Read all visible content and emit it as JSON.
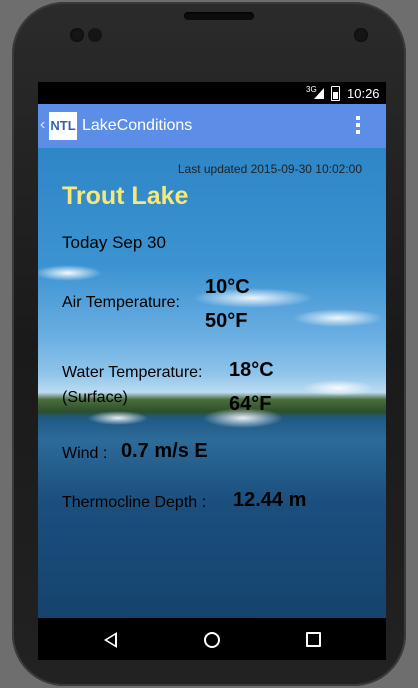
{
  "status_bar": {
    "network": "3G",
    "time": "10:26"
  },
  "action_bar": {
    "app_icon_text": "NTL",
    "title": "LakeConditions",
    "overflow_icon": "more-vert-icon"
  },
  "main": {
    "last_updated": "Last updated 2015-09-30 10:02:00",
    "lake_name": "Trout Lake",
    "today": "Today Sep  30",
    "air_temperature": {
      "label": "Air Temperature:",
      "celsius": "10°C",
      "fahrenheit": "50°F"
    },
    "water_temperature": {
      "label": "Water Temperature:",
      "sublabel": "(Surface)",
      "celsius": "18°C",
      "fahrenheit": "64°F"
    },
    "wind": {
      "label": "Wind :",
      "value": "0.7 m/s E"
    },
    "thermocline": {
      "label": "Thermocline Depth :",
      "value": "12.44 m"
    }
  },
  "nav_bar": {
    "back_icon": "back-triangle-icon",
    "home_icon": "home-circle-icon",
    "recents_icon": "recents-square-icon"
  },
  "colors": {
    "action_bar": "#5c8ee8",
    "lake_name": "#f6e97a"
  }
}
